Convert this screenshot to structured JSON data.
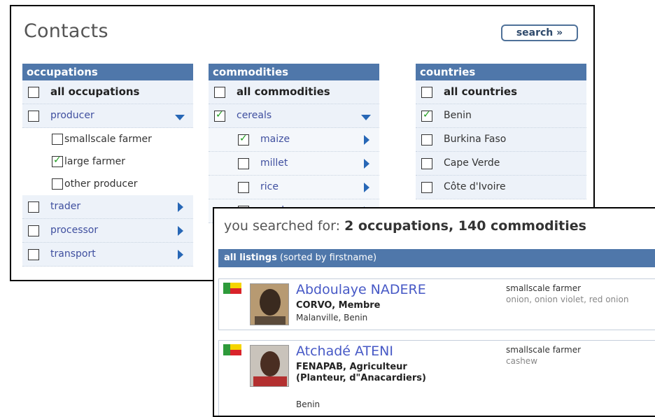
{
  "contacts": {
    "title": "Contacts",
    "search_label": "search »",
    "occupations": {
      "header": "occupations",
      "all_label": "all occupations",
      "items": [
        {
          "label": "producer",
          "checked": false,
          "expanded": true
        },
        {
          "label": "smallscale farmer",
          "checked": false
        },
        {
          "label": "large farmer",
          "checked": true
        },
        {
          "label": "other producer",
          "checked": false
        },
        {
          "label": "trader",
          "checked": false
        },
        {
          "label": "processor",
          "checked": false
        },
        {
          "label": "transport",
          "checked": false
        }
      ]
    },
    "commodities": {
      "header": "commodities",
      "all_label": "all commodities",
      "items": [
        {
          "label": "cereals",
          "checked": true,
          "expanded": true
        },
        {
          "label": "maize",
          "checked": true
        },
        {
          "label": "millet",
          "checked": false
        },
        {
          "label": "rice",
          "checked": false
        },
        {
          "label": "sorghum",
          "checked": false
        }
      ]
    },
    "countries": {
      "header": "countries",
      "all_label": "all countries",
      "items": [
        {
          "label": "Benin",
          "checked": true
        },
        {
          "label": "Burkina Faso",
          "checked": false
        },
        {
          "label": "Cape Verde",
          "checked": false
        },
        {
          "label": "Côte d'Ivoire",
          "checked": false
        }
      ]
    }
  },
  "results": {
    "searched_prefix": "you searched for:",
    "searched_terms": "2 occupations, 140 commodities",
    "listing_title": "all listings",
    "listing_sort": "(sorted by firstname)",
    "people": [
      {
        "name": "Abdoulaye NADERE",
        "org": "CORVO, Membre",
        "location": "Malanville, Benin",
        "occupation": "smallscale farmer",
        "commodities": "onion, onion violet, red onion"
      },
      {
        "name": "Atchadé ATENI",
        "org": "FENAPAB, Agriculteur (Planteur, d\"Anacardiers)",
        "location": "Benin",
        "occupation": "smallscale farmer",
        "commodities": "cashew"
      }
    ]
  },
  "icons": {
    "flag": "benin-flag-icon",
    "expand": "chevron-down-icon",
    "collapsed": "chevron-right-icon"
  },
  "colors": {
    "header_bg": "#4f77aa",
    "link": "#3f4f9f",
    "check": "#1e9c1e"
  }
}
